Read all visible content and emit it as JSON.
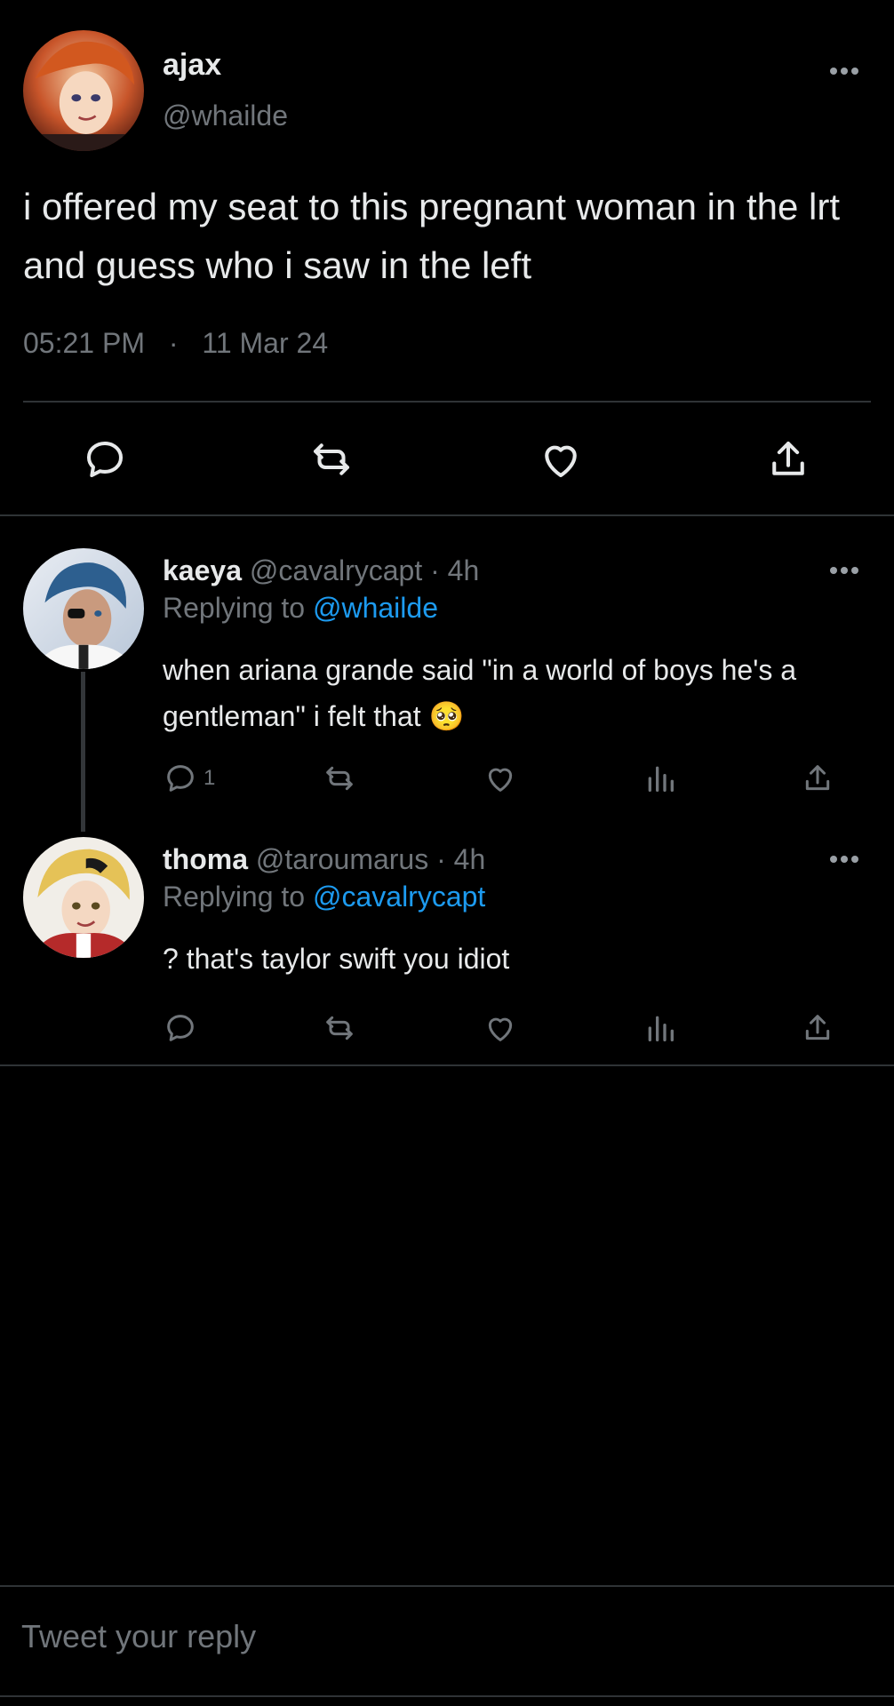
{
  "main_tweet": {
    "display_name": "ajax",
    "handle": "@whailde",
    "text": "i offered my seat to this pregnant woman in the lrt and guess who i saw in the left",
    "time": "05:21 PM",
    "separator": "·",
    "date": "11 Mar 24",
    "actions": [
      "reply-icon",
      "retweet-icon",
      "like-icon",
      "share-icon"
    ]
  },
  "replies": [
    {
      "display_name": "kaeya",
      "handle": "@cavalrycapt",
      "age": "· 4h",
      "replying_prefix": "Replying to",
      "replying_to": "@whailde",
      "text": "when ariana grande said \"in a world of boys he's a gentleman\" i felt that",
      "emoji": "🥺",
      "reply_count": "1"
    },
    {
      "display_name": "thoma",
      "handle": "@taroumarus",
      "age": "· 4h",
      "replying_prefix": "Replying to",
      "replying_to": "@cavalrycapt",
      "text": "? that's taylor swift you idiot",
      "reply_count": ""
    }
  ],
  "compose": {
    "placeholder": "Tweet your reply"
  },
  "colors": {
    "background": "#000000",
    "text": "#e7e9ea",
    "muted": "#71767b",
    "link": "#1d9bf0",
    "divider": "#2f3336"
  }
}
